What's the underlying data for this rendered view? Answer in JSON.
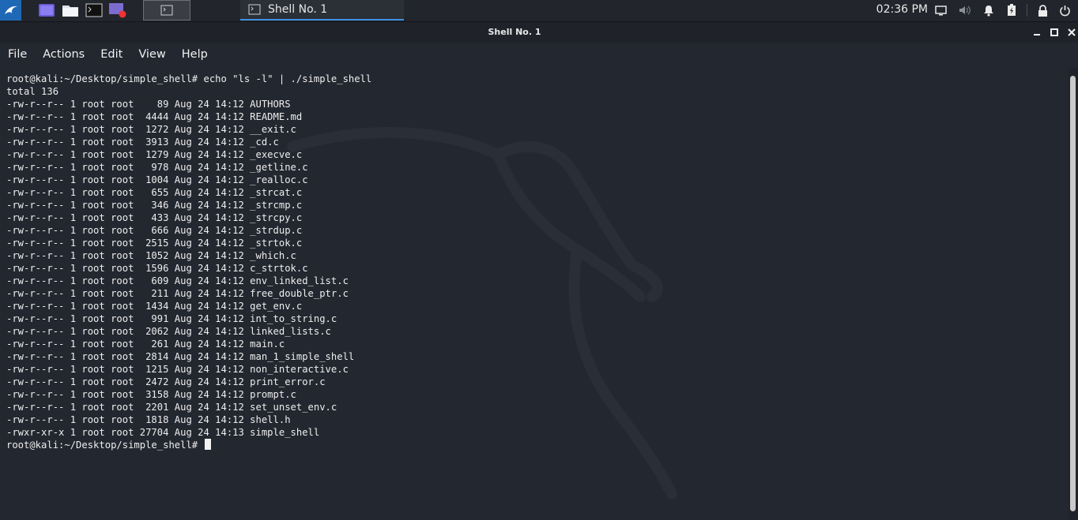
{
  "taskbar": {
    "task_title": "Shell No. 1",
    "clock": "02:36 PM"
  },
  "window": {
    "title": "Shell No. 1"
  },
  "menu": [
    "File",
    "Actions",
    "Edit",
    "View",
    "Help"
  ],
  "terminal": {
    "prompt": "root@kali:~/Desktop/simple_shell# ",
    "command": "echo \"ls -l\" | ./simple_shell",
    "lines": [
      "total 136",
      "-rw-r--r-- 1 root root    89 Aug 24 14:12 AUTHORS",
      "-rw-r--r-- 1 root root  4444 Aug 24 14:12 README.md",
      "-rw-r--r-- 1 root root  1272 Aug 24 14:12 __exit.c",
      "-rw-r--r-- 1 root root  3913 Aug 24 14:12 _cd.c",
      "-rw-r--r-- 1 root root  1279 Aug 24 14:12 _execve.c",
      "-rw-r--r-- 1 root root   978 Aug 24 14:12 _getline.c",
      "-rw-r--r-- 1 root root  1004 Aug 24 14:12 _realloc.c",
      "-rw-r--r-- 1 root root   655 Aug 24 14:12 _strcat.c",
      "-rw-r--r-- 1 root root   346 Aug 24 14:12 _strcmp.c",
      "-rw-r--r-- 1 root root   433 Aug 24 14:12 _strcpy.c",
      "-rw-r--r-- 1 root root   666 Aug 24 14:12 _strdup.c",
      "-rw-r--r-- 1 root root  2515 Aug 24 14:12 _strtok.c",
      "-rw-r--r-- 1 root root  1052 Aug 24 14:12 _which.c",
      "-rw-r--r-- 1 root root  1596 Aug 24 14:12 c_strtok.c",
      "-rw-r--r-- 1 root root   609 Aug 24 14:12 env_linked_list.c",
      "-rw-r--r-- 1 root root   211 Aug 24 14:12 free_double_ptr.c",
      "-rw-r--r-- 1 root root  1434 Aug 24 14:12 get_env.c",
      "-rw-r--r-- 1 root root   991 Aug 24 14:12 int_to_string.c",
      "-rw-r--r-- 1 root root  2062 Aug 24 14:12 linked_lists.c",
      "-rw-r--r-- 1 root root   261 Aug 24 14:12 main.c",
      "-rw-r--r-- 1 root root  2814 Aug 24 14:12 man_1_simple_shell",
      "-rw-r--r-- 1 root root  1215 Aug 24 14:12 non_interactive.c",
      "-rw-r--r-- 1 root root  2472 Aug 24 14:12 print_error.c",
      "-rw-r--r-- 1 root root  3158 Aug 24 14:12 prompt.c",
      "-rw-r--r-- 1 root root  2201 Aug 24 14:12 set_unset_env.c",
      "-rw-r--r-- 1 root root  1818 Aug 24 14:12 shell.h",
      "-rwxr-xr-x 1 root root 27704 Aug 24 14:13 simple_shell"
    ],
    "final_prompt": "root@kali:~/Desktop/simple_shell# "
  },
  "colors": {
    "background": "#232730",
    "panel": "#22252b",
    "accent": "#3f8fe0",
    "text": "#eeeeee"
  },
  "icons": {
    "kali_menu": "kali-dragon-icon",
    "launchers": [
      "workspace-icon",
      "file-manager-icon",
      "terminal-icon",
      "screen-recorder-icon"
    ],
    "tray": [
      "display-icon",
      "volume-icon",
      "notification-bell-icon",
      "battery-icon",
      "lock-icon",
      "power-icon"
    ]
  }
}
